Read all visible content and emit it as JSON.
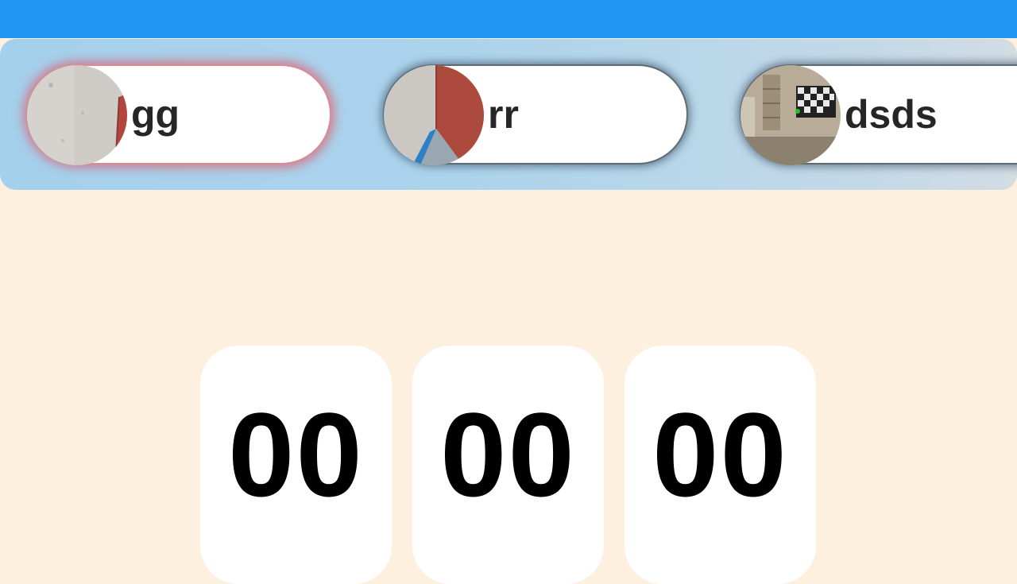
{
  "app_bar": {
    "color": "#2196f3"
  },
  "users": [
    {
      "name": "gg",
      "selected": true,
      "avatar_icon": "wall-photo"
    },
    {
      "name": "rr",
      "selected": false,
      "avatar_icon": "wall-corner-photo"
    },
    {
      "name": "dsds",
      "selected": false,
      "avatar_icon": "room-photo"
    }
  ],
  "timer": {
    "hours": "00",
    "minutes": "00",
    "seconds": "00"
  },
  "colors": {
    "background": "#fdf0df",
    "selected_glow": "#d98a94"
  }
}
